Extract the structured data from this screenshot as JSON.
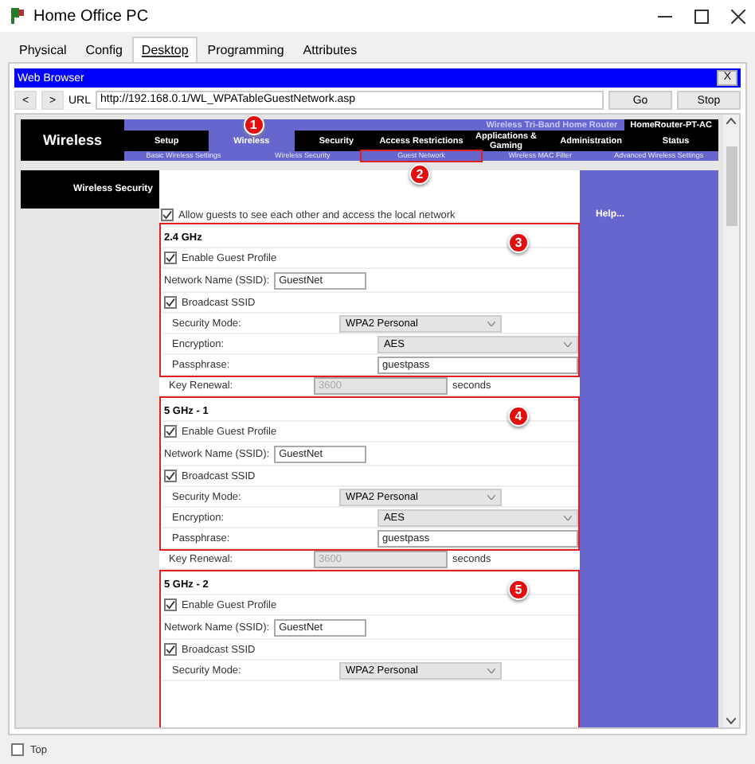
{
  "window": {
    "title": "Home Office PC"
  },
  "tabs": [
    {
      "label": "Physical",
      "selected": false
    },
    {
      "label": "Config",
      "selected": false
    },
    {
      "label": "Desktop",
      "selected": true
    },
    {
      "label": "Programming",
      "selected": false
    },
    {
      "label": "Attributes",
      "selected": false
    }
  ],
  "browser": {
    "title": "Web Browser",
    "close": "X",
    "back": "<",
    "forward": ">",
    "url_label": "URL",
    "url": "http://192.168.0.1/WL_WPATableGuestNetwork.asp",
    "go": "Go",
    "stop": "Stop"
  },
  "router": {
    "section": "Wireless",
    "product": "Wireless Tri-Band Home Router",
    "model": "HomeRouter-PT-AC",
    "nav": [
      {
        "label": "Setup",
        "selected": false
      },
      {
        "label": "Wireless",
        "selected": true,
        "callout": "1"
      },
      {
        "label": "Security",
        "selected": false
      },
      {
        "label": "Access Restrictions",
        "selected": false
      },
      {
        "label": "Applications & Gaming",
        "selected": false
      },
      {
        "label": "Administration",
        "selected": false
      },
      {
        "label": "Status",
        "selected": false
      }
    ],
    "subnav": [
      {
        "label": "Basic Wireless Settings",
        "selected": false
      },
      {
        "label": "Wireless Security",
        "selected": false
      },
      {
        "label": "Guest Network",
        "selected": true,
        "callout": "2"
      },
      {
        "label": "Wireless MAC Filter",
        "selected": false
      },
      {
        "label": "Advanced Wireless Settings",
        "selected": false
      }
    ]
  },
  "side_title": "Wireless Security",
  "allow_guests": {
    "label": "Allow guests to see each other and access the local network",
    "checked": true
  },
  "help": "Help...",
  "bands": [
    {
      "title": "2.4 GHz",
      "callout": "3",
      "enable": {
        "label": "Enable Guest Profile",
        "checked": true
      },
      "ssid_label": "Network Name (SSID):",
      "ssid": "GuestNet",
      "broadcast": {
        "label": "Broadcast SSID",
        "checked": true
      },
      "security_label": "Security Mode:",
      "security": "WPA2 Personal",
      "encryption_label": "Encryption:",
      "encryption": "AES",
      "passphrase_label": "Passphrase:",
      "passphrase": "guestpass",
      "key_label": "Key Renewal:",
      "key": "3600",
      "key_unit": "seconds"
    },
    {
      "title": "5 GHz - 1",
      "callout": "4",
      "enable": {
        "label": "Enable Guest Profile",
        "checked": true
      },
      "ssid_label": "Network Name (SSID):",
      "ssid": "GuestNet",
      "broadcast": {
        "label": "Broadcast SSID",
        "checked": true
      },
      "security_label": "Security Mode:",
      "security": "WPA2 Personal",
      "encryption_label": "Encryption:",
      "encryption": "AES",
      "passphrase_label": "Passphrase:",
      "passphrase": "guestpass",
      "key_label": "Key Renewal:",
      "key": "3600",
      "key_unit": "seconds"
    },
    {
      "title": "5 GHz - 2",
      "callout": "5",
      "enable": {
        "label": "Enable Guest Profile",
        "checked": true
      },
      "ssid_label": "Network Name (SSID):",
      "ssid": "GuestNet",
      "broadcast": {
        "label": "Broadcast SSID",
        "checked": true
      },
      "security_label": "Security Mode:",
      "security": "WPA2 Personal"
    }
  ],
  "footer": {
    "label": "Top",
    "checked": false
  }
}
